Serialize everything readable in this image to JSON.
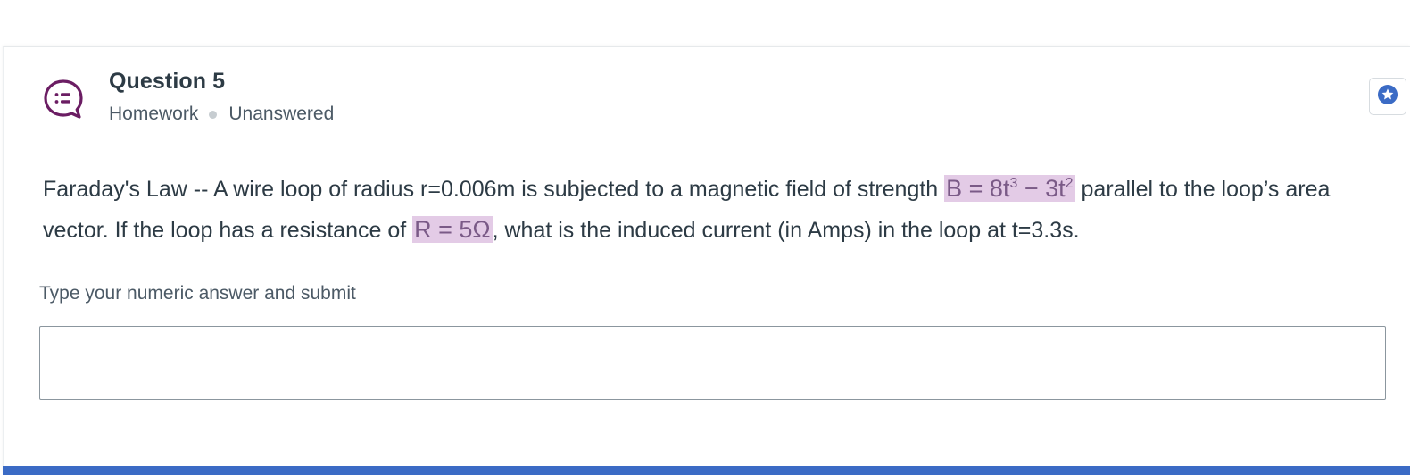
{
  "question": {
    "title": "Question 5",
    "type": "Homework",
    "status": "Unanswered",
    "text_part1": "Faraday's Law -- A wire loop of radius r=0.006m is subjected to a magnetic field of strength ",
    "math_field": "B = 8t",
    "math_field_exp1": "3",
    "math_field_mid": " − 3t",
    "math_field_exp2": "2",
    "text_part2": " parallel to the loop’s area vector. If the loop has a resistance of ",
    "math_resistance": "R = 5Ω",
    "text_part3": ", what is the induced current (in Amps) in the loop at t=3.3s."
  },
  "answer": {
    "label": "Type your numeric answer and submit",
    "value": "",
    "placeholder": ""
  },
  "icons": {
    "question": "question-list-bubble-icon",
    "bookmark": "star-bookmark-icon"
  },
  "colors": {
    "icon_accent": "#6b1d63",
    "bookmark_accent": "#3b6bc5",
    "math_highlight": "#e3cbe6",
    "bottom_bar": "#3b6bc5"
  }
}
